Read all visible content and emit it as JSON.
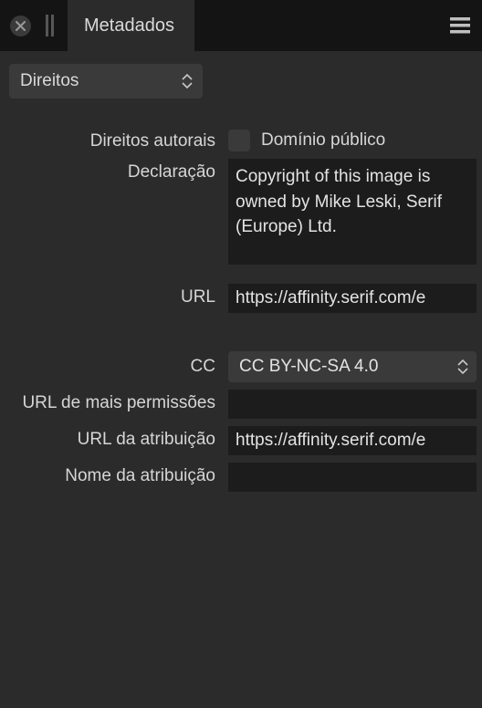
{
  "titlebar": {
    "tab_label": "Metadados"
  },
  "section_dropdown": {
    "selected": "Direitos"
  },
  "fields": {
    "rights_label": "Direitos autorais",
    "public_domain_label": "Domínio público",
    "statement_label": "Declaração",
    "statement_value": "Copyright of this image is owned by Mike Leski, Serif (Europe) Ltd.",
    "url_label": "URL",
    "url_value": "https://affinity.serif.com/e",
    "cc_label": "CC",
    "cc_value": "CC BY-NC-SA 4.0",
    "more_perms_label": "URL de mais permissões",
    "more_perms_value": "",
    "attr_url_label": "URL da atribuição",
    "attr_url_value": "https://affinity.serif.com/e",
    "attr_name_label": "Nome da atribuição",
    "attr_name_value": ""
  }
}
